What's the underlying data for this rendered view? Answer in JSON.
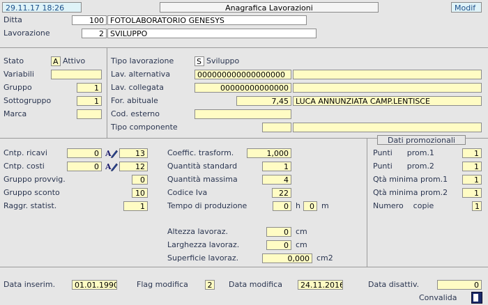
{
  "header": {
    "datetime": "29.11.17 18:26",
    "title": "Anagrafica Lavorazioni",
    "mode": "Modif"
  },
  "top": {
    "ditta_label": "Ditta",
    "ditta_code": "100",
    "ditta_name": "FOTOLABORATORIO GENESYS",
    "lav_label": "Lavorazione",
    "lav_code": "2",
    "lav_name": "SVILUPPO"
  },
  "left": {
    "stato_label": "Stato",
    "stato_code": "A",
    "stato_desc": "Attivo",
    "variabili_label": "Variabili",
    "variabili_value": "",
    "gruppo_label": "Gruppo",
    "gruppo_value": "1",
    "sottogruppo_label": "Sottogruppo",
    "sottogruppo_value": "1",
    "marca_label": "Marca",
    "marca_value": ""
  },
  "right": {
    "tipo_lav_label": "Tipo lavorazione",
    "tipo_lav_code": "S",
    "tipo_lav_desc": "Sviluppo",
    "lav_alt_label": "Lav. alternativa",
    "lav_alt_value": "000000000000000000",
    "lav_alt_desc": "",
    "lav_coll_label": "Lav. collegata",
    "lav_coll_value": "00000000000000",
    "lav_coll_desc": "",
    "for_label": "For. abituale",
    "for_value": "7,45",
    "for_desc": "LUCA ANNUNZIATA  CAMP.LENTISCE",
    "cod_est_label": "Cod. esterno",
    "cod_est_value": "",
    "tipo_comp_label": "Tipo componente",
    "tipo_comp_value": "",
    "tipo_comp_desc": ""
  },
  "mid_left": {
    "ricavi_label": "Cntp.  ricavi",
    "ricavi_value": "0",
    "ricavi_code": "13",
    "costi_label": "Cntp.  costi",
    "costi_value": "0",
    "costi_code": "12",
    "provvig_label": "Gruppo provvig.",
    "provvig_value": "0",
    "sconto_label": "Gruppo sconto",
    "sconto_value": "10",
    "raggr_label": "Raggr. statist.",
    "raggr_value": "1"
  },
  "mid_center": {
    "coeff_label": "Coeffic. trasform.",
    "coeff_value": "1,000",
    "qty_std_label": "Quantità standard",
    "qty_std_value": "1",
    "qty_max_label": "Quantità massima",
    "qty_max_value": "4",
    "iva_label": "Codice   Iva",
    "iva_value": "22",
    "tempo_label": "Tempo di produzione",
    "tempo_h": "0",
    "h_unit": "h",
    "tempo_m": "0",
    "m_unit": "m",
    "altezza_label": "Altezza   lavoraz.",
    "altezza_value": "0",
    "altezza_unit": "cm",
    "larghezza_label": "Larghezza  lavoraz.",
    "larghezza_value": "0",
    "larghezza_unit": "cm",
    "superficie_label": "Superficie lavoraz.",
    "superficie_value": "0,000",
    "superficie_unit": "cm2"
  },
  "promo": {
    "title": "Dati promozionali",
    "punti1_label": "Punti      prom.1",
    "punti1_value": "1",
    "punti2_label": "Punti      prom.2",
    "punti2_value": "1",
    "qta1_label": "Qtà minima prom.1",
    "qta1_value": "1",
    "qta2_label": "Qtà minima prom.2",
    "qta2_value": "1",
    "copie_label": "Numero    copie",
    "copie_value": "1"
  },
  "footer": {
    "inserim_label": "Data inserim.",
    "inserim_value": "01.01.1990",
    "flag_label": "Flag modifica",
    "flag_value": "2",
    "modifica_label": "Data modifica",
    "modifica_value": "24.11.2016",
    "disatt_label": "Data disattiv.",
    "disatt_value": "0",
    "convalida_label": "Convalida"
  }
}
